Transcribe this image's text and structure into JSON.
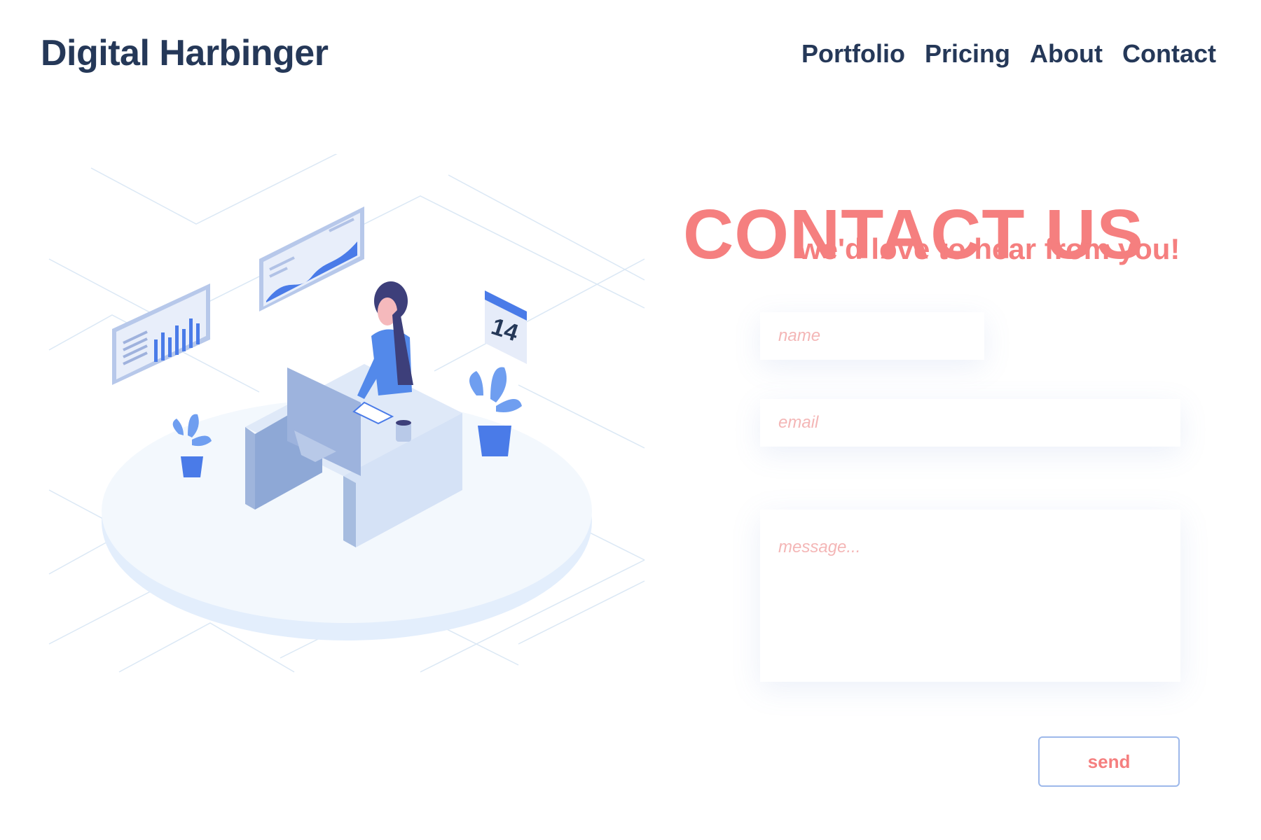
{
  "header": {
    "brand": "Digital Harbinger",
    "nav": [
      "Portfolio",
      "Pricing",
      "About",
      "Contact"
    ]
  },
  "hero": {
    "title": "CONTACT US",
    "subtitle": "we'd love to hear from you!",
    "calendar_day": "14"
  },
  "form": {
    "name_placeholder": "name",
    "email_placeholder": "email",
    "message_placeholder": "message...",
    "send_label": "send"
  },
  "colors": {
    "brand_navy": "#253858",
    "accent_coral": "#f57f7f",
    "illustration_blue": "#4a7be8",
    "button_border": "#9db8ea"
  }
}
